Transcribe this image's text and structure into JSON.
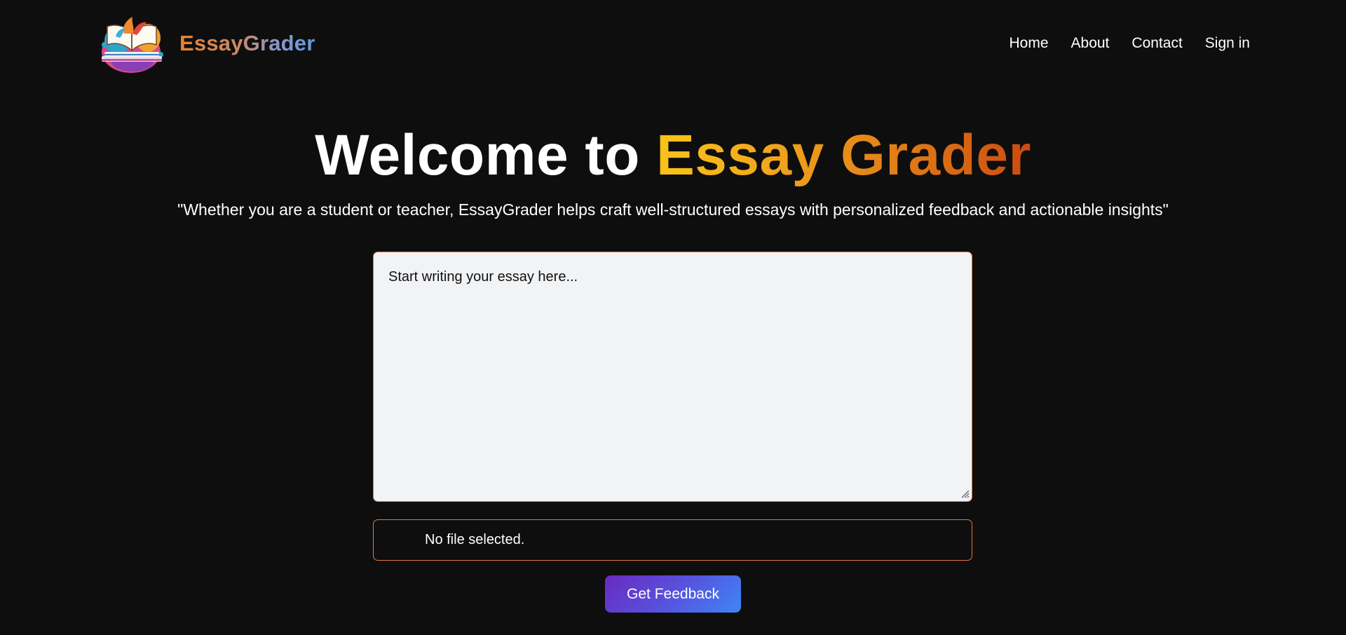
{
  "header": {
    "brand_name": "EssayGrader",
    "nav": [
      {
        "label": "Home"
      },
      {
        "label": "About"
      },
      {
        "label": "Contact"
      },
      {
        "label": "Sign in"
      }
    ]
  },
  "hero": {
    "title_prefix": "Welcome to",
    "title_accent": "Essay Grader",
    "tagline": "\"Whether you are a student or teacher, EssayGrader helps craft well-structured essays with personalized feedback and actionable insights\""
  },
  "form": {
    "essay_placeholder": "Start writing your essay here...",
    "essay_value": "",
    "file_status": "No file selected.",
    "submit_label": "Get Feedback"
  },
  "colors": {
    "background": "#0e0e0f",
    "border_accent": "#e8753a",
    "title_gradient": [
      "#fac418",
      "#cc4a10"
    ],
    "button_gradient": [
      "#6a2ac0",
      "#3f86f6"
    ]
  }
}
